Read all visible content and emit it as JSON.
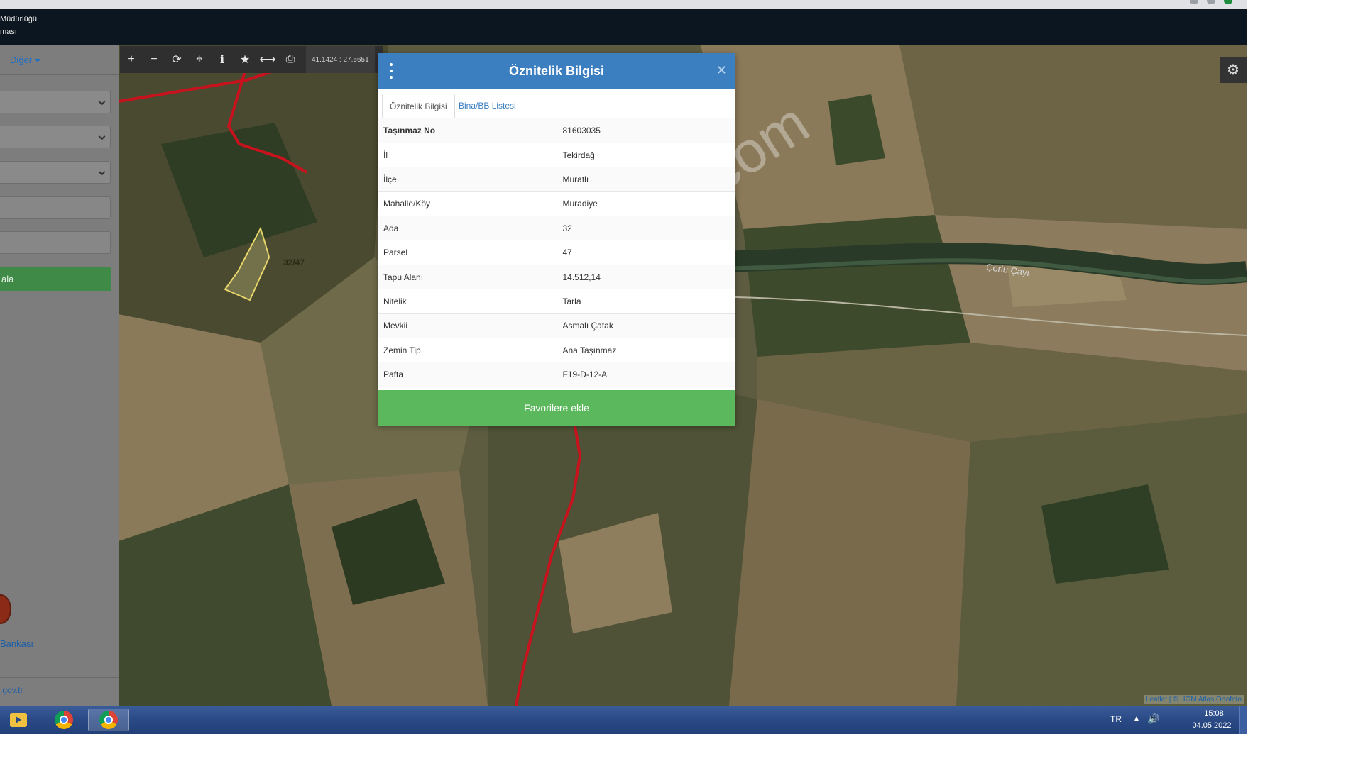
{
  "header": {
    "line1": "Müdürlüğü",
    "line2": "ması"
  },
  "sidebar": {
    "more_menu": "Diğer",
    "query_button": "ala",
    "bank_label": "Bankası",
    "footer_link": ".gov.tr"
  },
  "toolbar": {
    "coords": "41.1424 : 27.5651"
  },
  "map": {
    "parcel_label": "32/47",
    "river_label": "Çorlu Çayı",
    "attribution": "Leaflet | © HGM Atlas Ortofoto"
  },
  "dialog": {
    "title": "Öznitelik Bilgisi",
    "tabs": [
      "Öznitelik Bilgisi",
      "Bina/BB Listesi"
    ],
    "rows": [
      {
        "key": "Taşınmaz No",
        "value": "81603035"
      },
      {
        "key": "İl",
        "value": "Tekirdağ"
      },
      {
        "key": "İlçe",
        "value": "Muratlı"
      },
      {
        "key": "Mahalle/Köy",
        "value": "Muradiye"
      },
      {
        "key": "Ada",
        "value": "32"
      },
      {
        "key": "Parsel",
        "value": "47"
      },
      {
        "key": "Tapu Alanı",
        "value": "14.512,14"
      },
      {
        "key": "Nitelik",
        "value": "Tarla"
      },
      {
        "key": "Mevkii",
        "value": "Asmalı Çatak"
      },
      {
        "key": "Zemin Tip",
        "value": "Ana Taşınmaz"
      },
      {
        "key": "Pafta",
        "value": "F19-D-12-A"
      }
    ],
    "favorite_button": "Favorilere ekle"
  },
  "watermark": "emlakjet.com",
  "taskbar": {
    "language": "TR",
    "time": "15:08",
    "date": "04.05.2022"
  },
  "colors": {
    "dialog_header": "#3c7fc1",
    "favorite_button": "#5cb85c",
    "boundary_line": "#c8121e"
  }
}
